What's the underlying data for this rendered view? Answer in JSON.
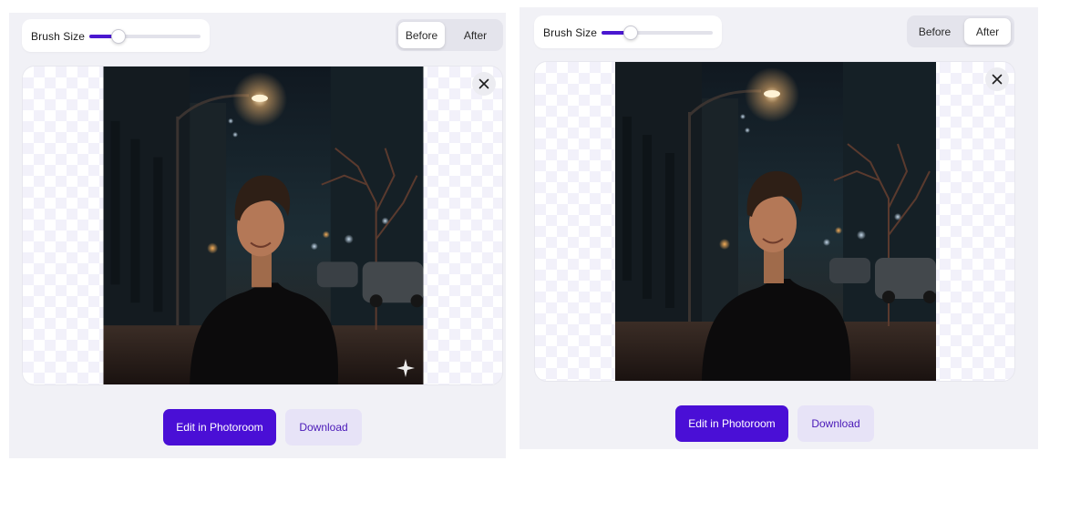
{
  "panels": [
    {
      "brush_size_label": "Brush Size",
      "brush_size_fraction": 0.25,
      "toggle": {
        "before_label": "Before",
        "after_label": "After",
        "active": "before"
      },
      "actions": {
        "edit_label": "Edit in Photoroom",
        "download_label": "Download"
      },
      "has_sparkle": true
    },
    {
      "brush_size_label": "Brush Size",
      "brush_size_fraction": 0.25,
      "toggle": {
        "before_label": "Before",
        "after_label": "After",
        "active": "after"
      },
      "actions": {
        "edit_label": "Edit in Photoroom",
        "download_label": "Download"
      },
      "has_sparkle": false
    }
  ],
  "icons": {
    "close": "close-icon",
    "sparkle": "sparkle-icon"
  },
  "colors": {
    "accent": "#4a0fd6",
    "slider_fill": "#4a17d0",
    "secondary_button_bg": "#e7e3f7",
    "secondary_button_text": "#4a19b8",
    "panel_bg": "#f1f1f6"
  }
}
